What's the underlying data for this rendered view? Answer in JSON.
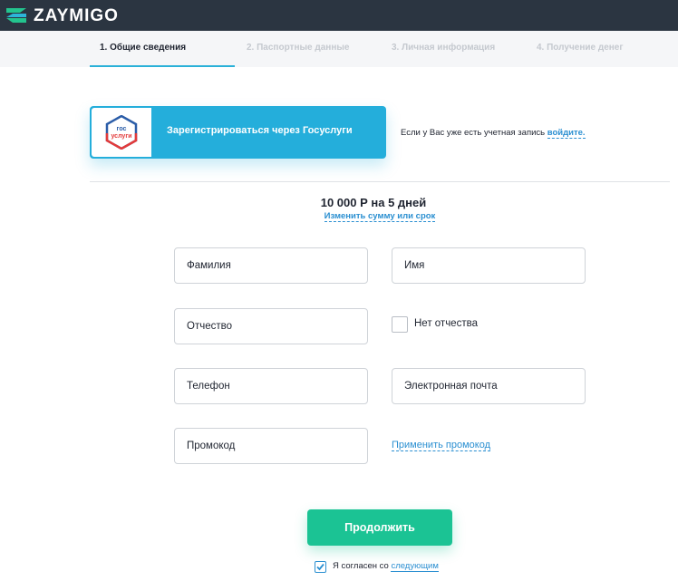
{
  "header": {
    "logo_text": "ZAYMIGO",
    "logo_icon": "zaymigo-logo-icon"
  },
  "steps": [
    {
      "label": "1. Общие сведения",
      "active": true
    },
    {
      "label": "2. Паспортные данные",
      "active": false
    },
    {
      "label": "3. Личная информация",
      "active": false
    },
    {
      "label": "4. Получение денег",
      "active": false
    }
  ],
  "gosuslugi": {
    "logo_line1": "гос",
    "logo_line2": "услуги",
    "button_label": "Зарегистрироваться через Госуслуги",
    "login_hint": "Если у Вас уже есть учетная запись",
    "login_link": "войдите."
  },
  "loan": {
    "summary": "10 000 Р на 5 дней",
    "change_link": "Изменить сумму или срок"
  },
  "form": {
    "last_name_placeholder": "Фамилия",
    "first_name_placeholder": "Имя",
    "patronymic_placeholder": "Отчество",
    "no_patronymic_label": "Нет отчества",
    "no_patronymic_checked": false,
    "phone_placeholder": "Телефон",
    "email_placeholder": "Электронная почта",
    "promo_placeholder": "Промокод",
    "promo_apply": "Применить промокод"
  },
  "actions": {
    "continue_label": "Продолжить"
  },
  "consent": {
    "checked": true,
    "text": "Я согласен со",
    "link": "следующим"
  },
  "colors": {
    "header_bg": "#2b3541",
    "accent_blue": "#24aedb",
    "link": "#2a8fd1",
    "continue_green": "#1bc394"
  }
}
